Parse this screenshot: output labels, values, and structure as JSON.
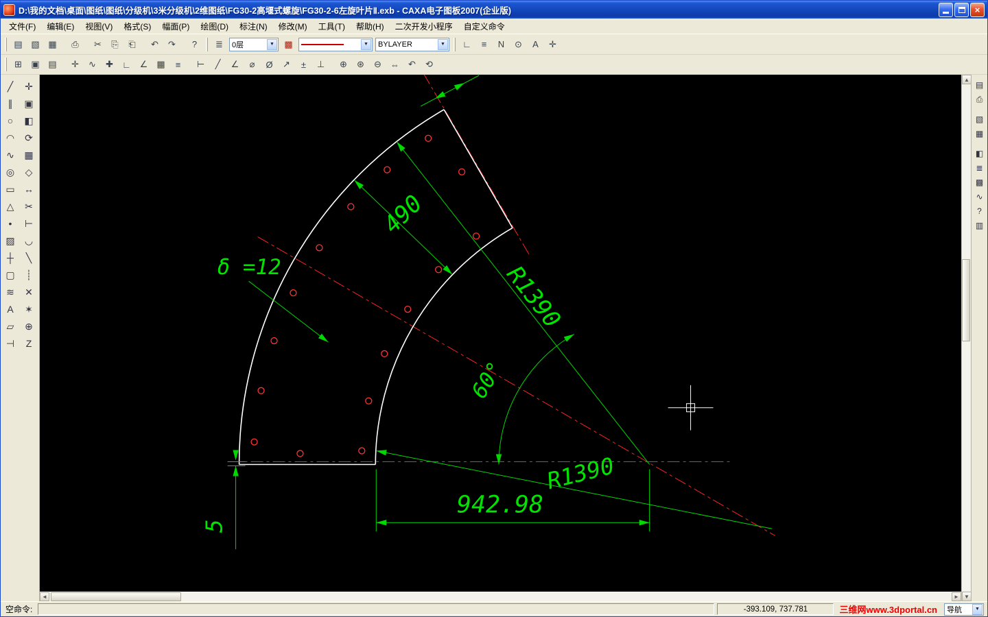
{
  "window": {
    "title": "D:\\我的文档\\桌面\\图纸\\图纸\\分级机\\3米分级机\\2维图纸\\FG30-2高堰式螺旋\\FG30-2-6左旋叶片Ⅱ.exb - CAXA电子图板2007(企业版)",
    "close_glyph": "×"
  },
  "menu": {
    "items": [
      {
        "name": "menu-item-file",
        "label": "文件(F)"
      },
      {
        "name": "menu-item-edit",
        "label": "编辑(E)"
      },
      {
        "name": "menu-item-view",
        "label": "视图(V)"
      },
      {
        "name": "menu-item-format",
        "label": "格式(S)"
      },
      {
        "name": "menu-item-sheet",
        "label": "幅面(P)"
      },
      {
        "name": "menu-item-draw",
        "label": "绘图(D)"
      },
      {
        "name": "menu-item-dimension",
        "label": "标注(N)"
      },
      {
        "name": "menu-item-modify",
        "label": "修改(M)"
      },
      {
        "name": "menu-item-tools",
        "label": "工具(T)"
      },
      {
        "name": "menu-item-help",
        "label": "帮助(H)"
      },
      {
        "name": "menu-item-addons",
        "label": "二次开发小程序"
      },
      {
        "name": "menu-item-custom-commands",
        "label": "自定义命令"
      }
    ]
  },
  "toolbar1": {
    "buttons": [
      {
        "name": "new-button",
        "glyph": "▤"
      },
      {
        "name": "open-button",
        "glyph": "▧"
      },
      {
        "name": "save-button",
        "glyph": "▦"
      },
      {
        "name": "print-button",
        "glyph": "⎙",
        "gap": true
      },
      {
        "name": "cut-button",
        "glyph": "✂",
        "gap": true
      },
      {
        "name": "copy-button",
        "glyph": "⎘"
      },
      {
        "name": "paste-button",
        "glyph": "⎗"
      },
      {
        "name": "undo-button",
        "glyph": "↶",
        "gap": true
      },
      {
        "name": "redo-button",
        "glyph": "↷"
      },
      {
        "name": "help-button",
        "glyph": "?",
        "gap": true
      }
    ],
    "layer_button_glyph": "≣",
    "layer_value": "0层",
    "color_button_glyph": "▩",
    "lineweight_value": "BYLAYER",
    "extra": [
      {
        "name": "ortho-button",
        "glyph": "∟"
      },
      {
        "name": "linewidth-button",
        "glyph": "≡"
      },
      {
        "name": "dynamic-input-button",
        "glyph": "N"
      },
      {
        "name": "osnap-button",
        "glyph": "⊙"
      },
      {
        "name": "text-style-button",
        "glyph": "A"
      },
      {
        "name": "options-button",
        "glyph": "✛"
      }
    ]
  },
  "toolbar2": {
    "buttons": [
      {
        "name": "zoom-all-button",
        "glyph": "⊞"
      },
      {
        "name": "zoom-window-button",
        "glyph": "▣"
      },
      {
        "name": "sheet-frame-button",
        "glyph": "▤"
      },
      {
        "name": "pick-button",
        "glyph": "✛",
        "gap": true
      },
      {
        "name": "node-edit-button",
        "glyph": "∿"
      },
      {
        "name": "snap-settings-button",
        "glyph": "✚"
      },
      {
        "name": "ortho-mode-button",
        "glyph": "∟"
      },
      {
        "name": "polar-mode-button",
        "glyph": "∠"
      },
      {
        "name": "grid-button",
        "glyph": "▦"
      },
      {
        "name": "layer-control-button",
        "glyph": "≡"
      },
      {
        "name": "dim-linear-button",
        "glyph": "⊢",
        "gap": true
      },
      {
        "name": "dim-aligned-button",
        "glyph": "╱"
      },
      {
        "name": "dim-angle-button",
        "glyph": "∠"
      },
      {
        "name": "dim-radius-button",
        "glyph": "⌀"
      },
      {
        "name": "dim-diameter-button",
        "glyph": "Ø"
      },
      {
        "name": "leader-button",
        "glyph": "↗"
      },
      {
        "name": "tolerance-button",
        "glyph": "±"
      },
      {
        "name": "datum-button",
        "glyph": "⊥"
      },
      {
        "name": "zoom-in-button",
        "glyph": "⊕",
        "gap": true
      },
      {
        "name": "zoom-dynamic-button",
        "glyph": "⊛"
      },
      {
        "name": "zoom-out-button",
        "glyph": "⊖"
      },
      {
        "name": "pan-view-button",
        "glyph": "⇔"
      },
      {
        "name": "zoom-prev-button",
        "glyph": "↶"
      },
      {
        "name": "redraw-button",
        "glyph": "⟲"
      }
    ]
  },
  "left_toolbar": {
    "buttons": [
      {
        "name": "line-tool-button",
        "glyph": "╱"
      },
      {
        "name": "pan-tool-button",
        "glyph": "✛"
      },
      {
        "name": "parallel-line-tool-button",
        "glyph": "∥"
      },
      {
        "name": "copy-tool-button",
        "glyph": "▣"
      },
      {
        "name": "circle-tool-button",
        "glyph": "○"
      },
      {
        "name": "mirror-tool-button",
        "glyph": "◧"
      },
      {
        "name": "arc-tool-button",
        "glyph": "◠"
      },
      {
        "name": "rotate-tool-button",
        "glyph": "⟳"
      },
      {
        "name": "spline-tool-button",
        "glyph": "∿"
      },
      {
        "name": "array-tool-button",
        "glyph": "▦"
      },
      {
        "name": "ellipse-tool-button",
        "glyph": "◎"
      },
      {
        "name": "scale-tool-button",
        "glyph": "◇"
      },
      {
        "name": "rectangle-tool-button",
        "glyph": "▭"
      },
      {
        "name": "stretch-tool-button",
        "glyph": "↔"
      },
      {
        "name": "polygon-tool-button",
        "glyph": "△"
      },
      {
        "name": "trim-tool-button",
        "glyph": "✂"
      },
      {
        "name": "point-tool-button",
        "glyph": "•"
      },
      {
        "name": "extend-tool-button",
        "glyph": "⊢"
      },
      {
        "name": "hatch-tool-button",
        "glyph": "▨"
      },
      {
        "name": "fillet-tool-button",
        "glyph": "◡"
      },
      {
        "name": "centerline-tool-button",
        "glyph": "┼"
      },
      {
        "name": "chamfer-tool-button",
        "glyph": "╲"
      },
      {
        "name": "contour-tool-button",
        "glyph": "▢"
      },
      {
        "name": "break-tool-button",
        "glyph": "┊"
      },
      {
        "name": "offset-tool-button",
        "glyph": "≋"
      },
      {
        "name": "erase-tool-button",
        "glyph": "✕"
      },
      {
        "name": "text-tool-button",
        "glyph": "A"
      },
      {
        "name": "explode-tool-button",
        "glyph": "✶"
      },
      {
        "name": "block-tool-button",
        "glyph": "▱"
      },
      {
        "name": "zoom-tool-button",
        "glyph": "⊕"
      },
      {
        "name": "dimension-tool-button",
        "glyph": "⊣"
      },
      {
        "name": "query-tool-button",
        "glyph": "Z"
      }
    ]
  },
  "right_toolbar": {
    "buttons": [
      {
        "name": "sheet-settings-icon",
        "glyph": "▤"
      },
      {
        "name": "plot-icon",
        "glyph": "⎙"
      },
      {
        "name": "view-3d-icon",
        "glyph": "▧",
        "gaptop": true
      },
      {
        "name": "library-icon",
        "glyph": "▦"
      },
      {
        "name": "properties-icon",
        "glyph": "◧",
        "gaptop": true
      },
      {
        "name": "layers-panel-icon",
        "glyph": "≣"
      },
      {
        "name": "color-panel-icon",
        "glyph": "▩"
      },
      {
        "name": "linetype-panel-icon",
        "glyph": "∿"
      },
      {
        "name": "query-panel-icon",
        "glyph": "?"
      },
      {
        "name": "help-panel-icon",
        "glyph": "▥"
      }
    ]
  },
  "drawing": {
    "labels": {
      "arc_width": "490",
      "outer_radius": "R1390",
      "inner_radius": "R1390",
      "angle": "60°",
      "span": "942.98",
      "edge_offset": "5",
      "thickness": "δ =12"
    },
    "colors": {
      "geometry": "#ffffff",
      "centerline": "#ff2222",
      "dimension": "#00dd00",
      "holes": "#ff3333",
      "background": "#000000"
    }
  },
  "statusbar": {
    "prompt": "空命令:",
    "command_value": "",
    "coordinates": "-393.109, 737.781",
    "watermark": "三维网www.3dportal.cn",
    "snap_mode": "导航"
  }
}
